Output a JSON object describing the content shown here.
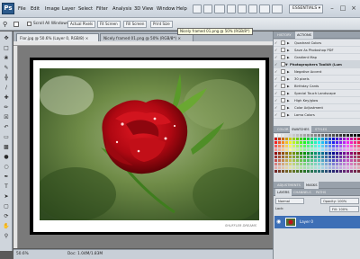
{
  "menubar": {
    "logo": "Ps",
    "items": [
      "File",
      "Edit",
      "Image",
      "Layer",
      "Select",
      "Filter",
      "Analysis",
      "3D",
      "View",
      "Window",
      "Help"
    ],
    "workspace": "ESSENTIALS ▾",
    "controls": [
      "–",
      "□",
      "×"
    ]
  },
  "options": {
    "sample_all_windows": "Scroll All Windows",
    "buttons": [
      "Actual Pixels",
      "Fit Screen",
      "Fill Screen",
      "Print Size"
    ],
    "tooltip": "Nicely framed 01.png @ 50% (RGB/8*)"
  },
  "tabs": [
    {
      "label": "Flor.jpg @ 50.6% (Layer 0, RGB/8) ×",
      "active": true
    },
    {
      "label": "Nicely framed 01.png @ 50% (RGB/8*) ×",
      "active": false
    }
  ],
  "canvas": {
    "watermark": "SHUFFLER DREAMS"
  },
  "status": {
    "zoom": "50.6%",
    "doc": "Doc: 1.04M/1.83M"
  },
  "panels": {
    "history_tabs": [
      "HISTORY",
      "ACTIONS"
    ],
    "history_rows": [
      {
        "label": "Quadrant Colors",
        "type": "action"
      },
      {
        "label": "Save As Photoshop PDF",
        "type": "action"
      },
      {
        "label": "Gradient Map",
        "type": "action"
      },
      {
        "label": "Photographers Toolkit (Lum",
        "type": "set"
      },
      {
        "label": "Negative Accent",
        "type": "action"
      },
      {
        "label": "30 pixels",
        "type": "action"
      },
      {
        "label": "Birthday Cards",
        "type": "action"
      },
      {
        "label": "Special Touch Landscape",
        "type": "action"
      },
      {
        "label": "High Key/glow",
        "type": "action"
      },
      {
        "label": "Color Adjustment",
        "type": "action"
      },
      {
        "label": "Lomo Colors",
        "type": "action"
      }
    ],
    "swatch_tabs": [
      "COLOR",
      "SWATCHES",
      "STYLES"
    ],
    "adjust_tabs": [
      "ADJUSTMENTS",
      "MASKS"
    ],
    "layer_tabs": [
      "LAYERS",
      "CHANNELS",
      "PATHS"
    ],
    "blend_mode": "Normal",
    "opacity": "Opacity: 100%",
    "lock": "Lock:",
    "fill": "Fill: 100%",
    "layer_name": "Layer 0"
  }
}
